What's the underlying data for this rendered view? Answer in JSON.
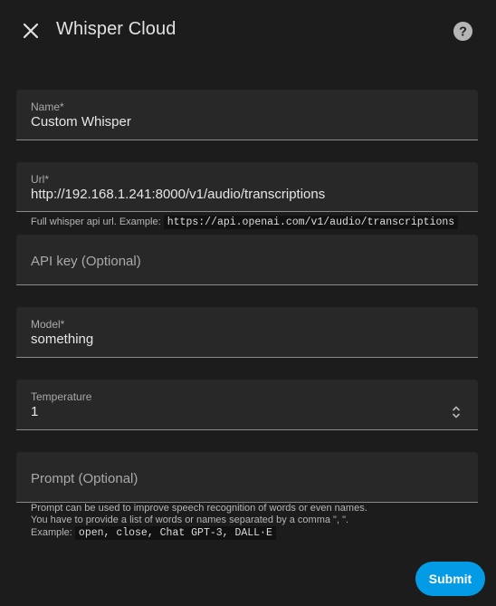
{
  "dialog": {
    "title": "Whisper Cloud",
    "close_icon": "close-icon",
    "help_icon": "help-icon"
  },
  "fields": {
    "name": {
      "label": "Name*",
      "value": "Custom Whisper"
    },
    "url": {
      "label": "Url*",
      "value": "http://192.168.1.241:8000/v1/audio/transcriptions",
      "helper_text": "Full whisper api url. Example:",
      "helper_code": "https://api.openai.com/v1/audio/transcriptions"
    },
    "api_key": {
      "placeholder": "API key (Optional)"
    },
    "model": {
      "label": "Model*",
      "value": "something"
    },
    "temperature": {
      "label": "Temperature",
      "value": "1",
      "stepper_icon": "unfold-icon"
    },
    "prompt": {
      "placeholder": "Prompt (Optional)",
      "helper_line1": "Prompt can be used to improve speech recognition of words or even names.",
      "helper_line2": "You have to provide a list of words or names separated by a comma \", \".",
      "helper_example_label": "Example:",
      "helper_code": "open, close, Chat GPT-3, DALL·E"
    }
  },
  "actions": {
    "submit_label": "Submit"
  },
  "colors": {
    "background": "#1c1c1c",
    "field": "#282828",
    "accent": "#039be5"
  }
}
